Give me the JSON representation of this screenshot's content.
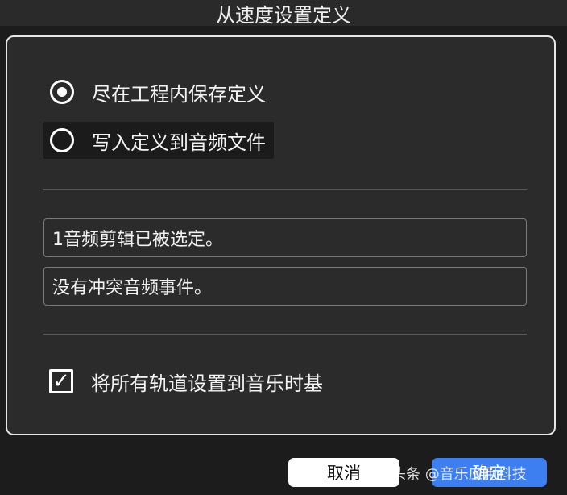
{
  "window": {
    "title": "从速度设置定义"
  },
  "options": {
    "radio_keep": {
      "label": "尽在工程内保存定义",
      "selected": true
    },
    "radio_write": {
      "label": "写入定义到音频文件",
      "selected": false
    }
  },
  "info": {
    "line1": "1音频剪辑已被选定。",
    "line2": "没有冲突音频事件。"
  },
  "checkbox": {
    "label": "将所有轨道设置到音乐时基",
    "checked": true,
    "check_glyph": "✓"
  },
  "buttons": {
    "cancel": "取消",
    "ok": "确定"
  },
  "watermark": "头条 @音乐应用科技",
  "colors": {
    "accent": "#3d7ff0",
    "panel": "#2b2b2b",
    "background": "#1c1c1c"
  }
}
